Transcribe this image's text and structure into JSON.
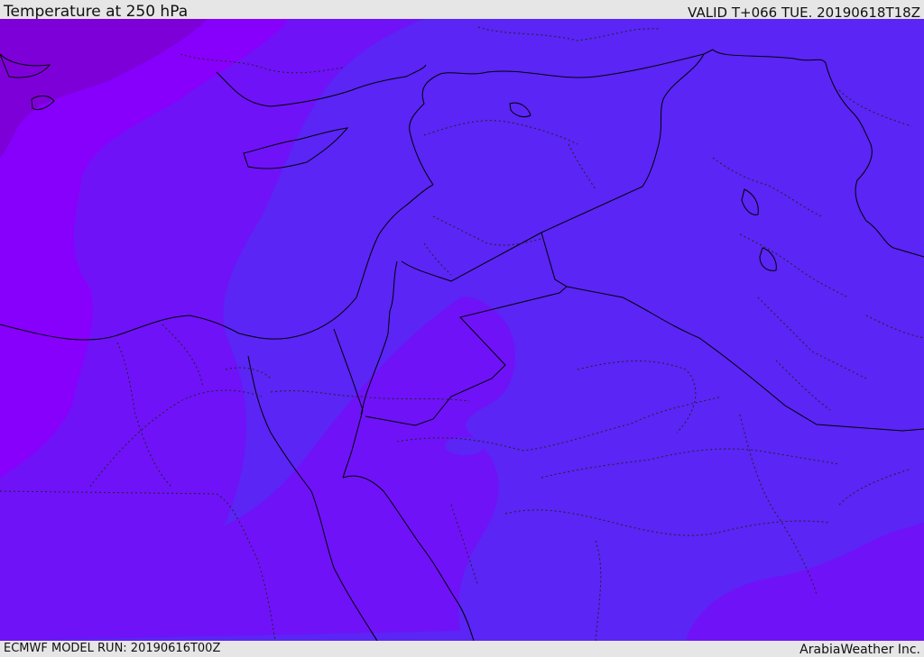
{
  "header": {
    "title": "Temperature at 250 hPa",
    "valid": "VALID T+066 TUE. 20190618T18Z"
  },
  "footer": {
    "model_run": "ECMWF MODEL RUN: 20190616T00Z",
    "credit": "ArabiaWeather Inc."
  },
  "map": {
    "field": "Temperature at 250 hPa",
    "colors": {
      "warm_band": "#5a25f5",
      "mid_band": "#6f12f8",
      "cool_band": "#8700fb",
      "cold_band": "#7e00d8",
      "border_line": "#000000"
    }
  }
}
